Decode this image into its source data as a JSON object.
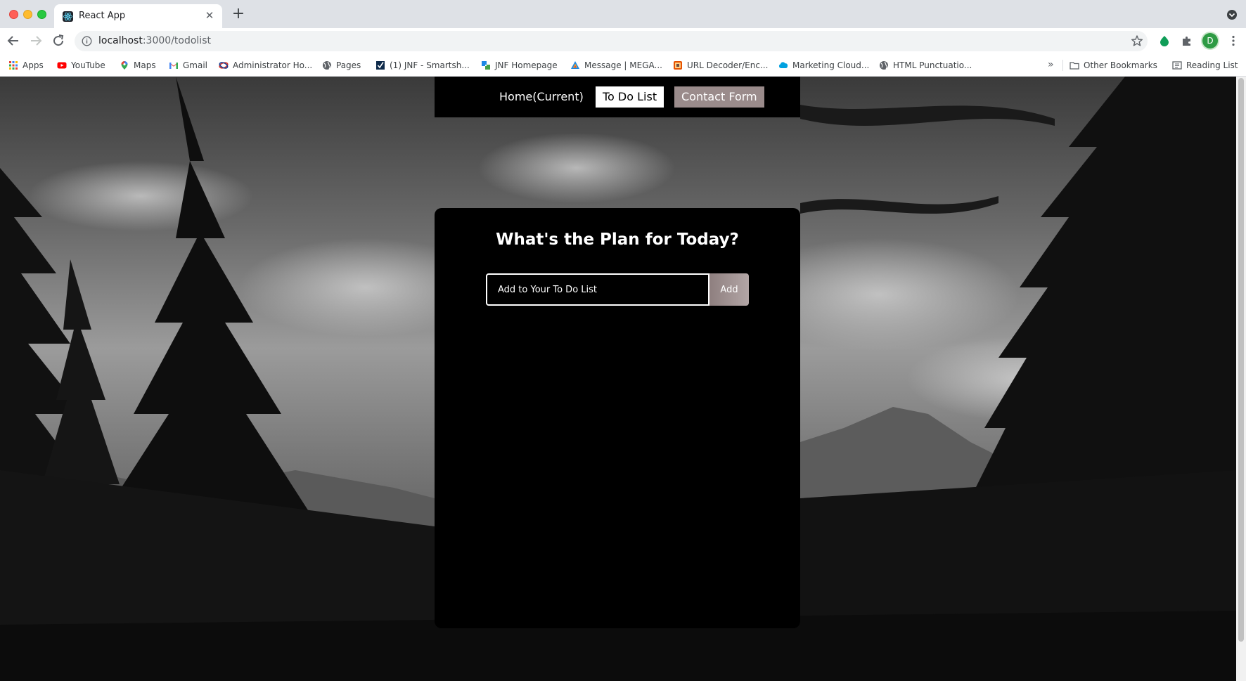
{
  "browser": {
    "tab_title": "React App",
    "url_host": "localhost",
    "url_rest": ":3000/todolist",
    "profile_initial": "D"
  },
  "bookmarks": [
    {
      "label": "Apps",
      "icon": "apps-grid-icon"
    },
    {
      "label": "YouTube",
      "icon": "youtube-icon"
    },
    {
      "label": "Maps",
      "icon": "maps-pin-icon"
    },
    {
      "label": "Gmail",
      "icon": "gmail-icon"
    },
    {
      "label": "Administrator Ho...",
      "icon": "admin-icon"
    },
    {
      "label": "Pages",
      "icon": "globe-icon"
    },
    {
      "label": "(1) JNF - Smartsh...",
      "icon": "smartsheet-icon"
    },
    {
      "label": "JNF Homepage",
      "icon": "jnf-icon"
    },
    {
      "label": "Message | MEGA...",
      "icon": "mega-icon"
    },
    {
      "label": "URL Decoder/Enc...",
      "icon": "decoder-icon"
    },
    {
      "label": "Marketing Cloud...",
      "icon": "salesforce-cloud-icon"
    },
    {
      "label": "HTML Punctuatio...",
      "icon": "globe-icon"
    }
  ],
  "bookmarks_right": {
    "other": "Other Bookmarks",
    "reading": "Reading List"
  },
  "nav": {
    "home": "Home(Current)",
    "todo": "To Do List",
    "contact": "Contact Form"
  },
  "todo": {
    "title": "What's the Plan for Today?",
    "placeholder": "Add to Your To Do List",
    "add_label": "Add"
  },
  "colors": {
    "card_bg": "#000000",
    "active_nav_bg": "#ffffff",
    "contact_nav_bg": "#9a8b8b",
    "add_button": "#a39595"
  }
}
